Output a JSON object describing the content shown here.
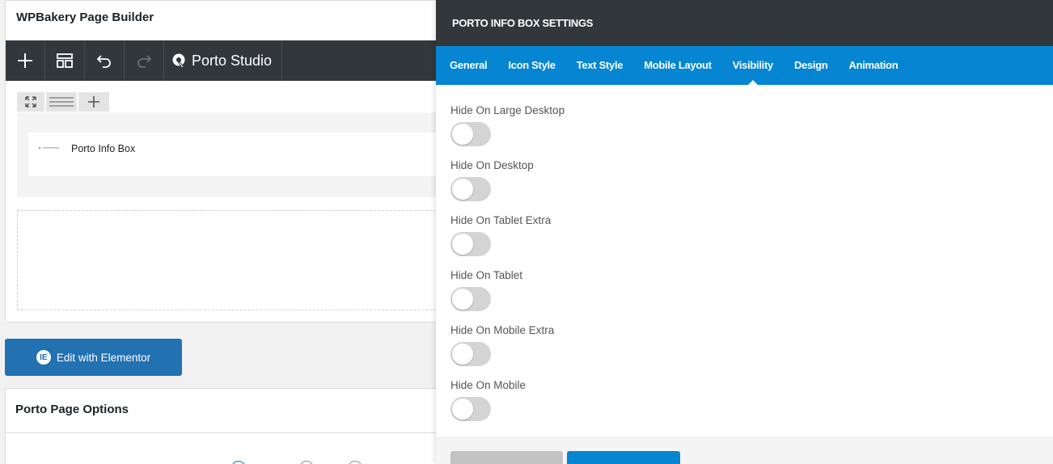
{
  "builder": {
    "title": "WPBakery Page Builder",
    "toolbar": {
      "add_icon": "plus-icon",
      "templates_icon": "layout-icon",
      "undo_icon": "undo-icon",
      "redo_icon": "redo-icon",
      "studio_label": "Porto Studio"
    },
    "element": {
      "name": "Porto Info Box"
    }
  },
  "elementor_button": {
    "label": "Edit with Elementor",
    "logo": "IE"
  },
  "page_options": {
    "title": "Porto Page Options"
  },
  "modal": {
    "title": "PORTO INFO BOX SETTINGS",
    "tabs": [
      {
        "label": "General"
      },
      {
        "label": "Icon Style"
      },
      {
        "label": "Text Style"
      },
      {
        "label": "Mobile Layout"
      },
      {
        "label": "Visibility",
        "active": true
      },
      {
        "label": "Design"
      },
      {
        "label": "Animation"
      }
    ],
    "fields": [
      {
        "label": "Hide On Large Desktop",
        "value": false
      },
      {
        "label": "Hide On Desktop",
        "value": false
      },
      {
        "label": "Hide On Tablet Extra",
        "value": false
      },
      {
        "label": "Hide On Tablet",
        "value": false
      },
      {
        "label": "Hide On Mobile Extra",
        "value": false
      },
      {
        "label": "Hide On Mobile",
        "value": false
      }
    ]
  },
  "colors": {
    "toolbar_dark": "#32373c",
    "tab_blue": "#0585d2",
    "button_blue": "#2271b1",
    "toggle_off": "#d4d4d4"
  }
}
